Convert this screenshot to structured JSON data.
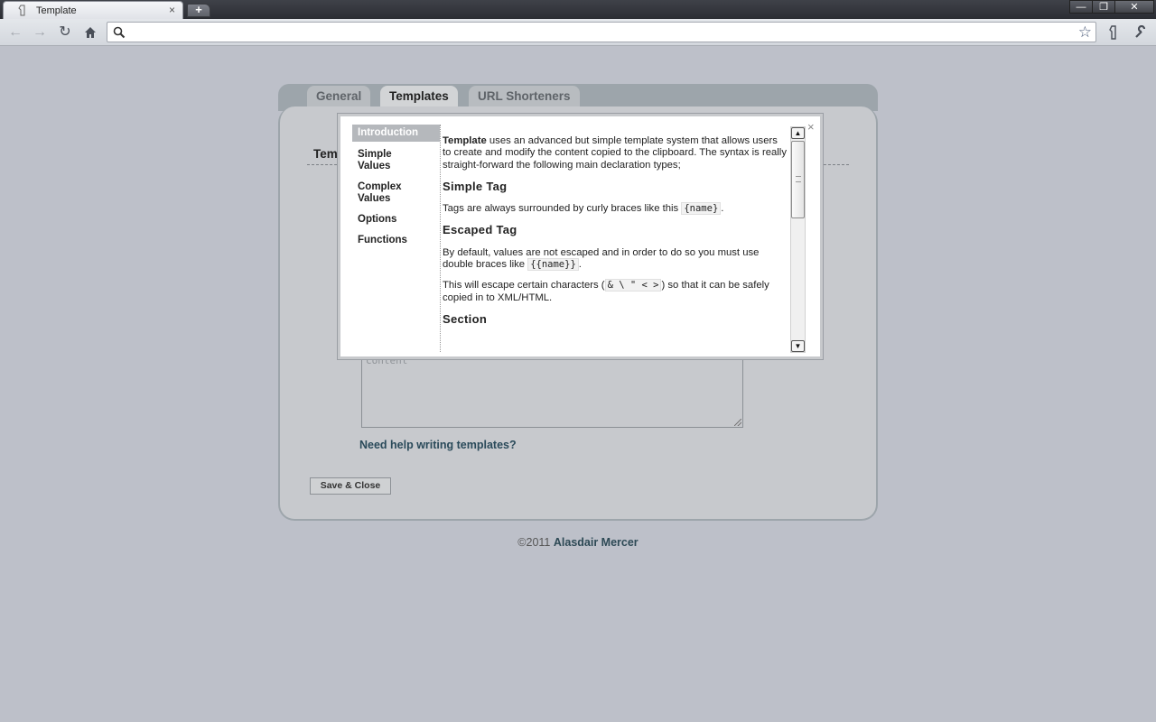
{
  "browser": {
    "tab_title": "Template",
    "tab_close": "×",
    "new_tab": "+",
    "window_buttons": {
      "minimize": "—",
      "restore": "❐",
      "close": "✕"
    },
    "address": ""
  },
  "page": {
    "tabs": [
      {
        "label": "General"
      },
      {
        "label": "Templates"
      },
      {
        "label": "URL Shorteners"
      }
    ],
    "active_tab": "Templates",
    "section_heading_partial": "Tem",
    "content_placeholder": "content",
    "help_link": "Need help writing templates?",
    "save_button": "Save & Close",
    "footer_prefix": "©2011 ",
    "footer_author": "Alasdair Mercer"
  },
  "modal": {
    "close": "×",
    "nav": [
      {
        "label": "Introduction"
      },
      {
        "label": "Simple Values"
      },
      {
        "label": "Complex Values"
      },
      {
        "label": "Options"
      },
      {
        "label": "Functions"
      }
    ],
    "active_nav": "Introduction",
    "intro": {
      "strong": "Template",
      "text": " uses an advanced but simple template system that allows users to create and modify the content copied to the clipboard. The syntax is really straight-forward the following main declaration types;"
    },
    "simple_tag": {
      "heading": "Simple Tag",
      "text_before": "Tags are always surrounded by curly braces like this ",
      "code": "{name}",
      "text_after": "."
    },
    "escaped_tag": {
      "heading": "Escaped Tag",
      "p1_before": "By default, values are not escaped and in order to do so you must use double braces like ",
      "p1_code": "{{name}}",
      "p1_after": ".",
      "p2_before": "This will escape certain characters (",
      "p2_code": "& \\ \" < >",
      "p2_after": ") so that it can be safely copied in to XML/HTML."
    },
    "section": {
      "heading": "Section"
    }
  }
}
